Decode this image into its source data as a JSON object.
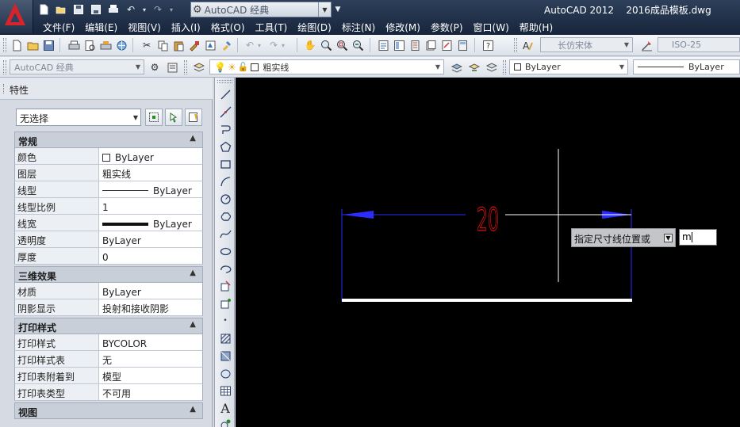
{
  "titlebar": {
    "app_name": "AutoCAD 2012",
    "file_name": "2016成品模板.dwg",
    "workspace": "AutoCAD 经典"
  },
  "menu": [
    "文件(F)",
    "编辑(E)",
    "视图(V)",
    "插入(I)",
    "格式(O)",
    "工具(T)",
    "绘图(D)",
    "标注(N)",
    "修改(M)",
    "参数(P)",
    "窗口(W)",
    "帮助(H)"
  ],
  "toolbar1": {
    "text_style": "长仿宋体",
    "dim_style": "ISO-25"
  },
  "toolbar2": {
    "workspace": "AutoCAD 经典",
    "layer": "粗实线",
    "color": "ByLayer",
    "linetype": "ByLayer"
  },
  "properties_palette": {
    "title": "特性",
    "selection": "无选择",
    "sections": [
      {
        "title": "常规",
        "rows": [
          {
            "key": "颜色",
            "value": "ByLayer",
            "marker": "swatch"
          },
          {
            "key": "图层",
            "value": "粗实线",
            "marker": ""
          },
          {
            "key": "线型",
            "value": "ByLayer",
            "marker": "line"
          },
          {
            "key": "线型比例",
            "value": "1",
            "marker": ""
          },
          {
            "key": "线宽",
            "value": "ByLayer",
            "marker": "thick"
          },
          {
            "key": "透明度",
            "value": "ByLayer",
            "marker": ""
          },
          {
            "key": "厚度",
            "value": "0",
            "marker": ""
          }
        ]
      },
      {
        "title": "三维效果",
        "rows": [
          {
            "key": "材质",
            "value": "ByLayer",
            "marker": ""
          },
          {
            "key": "阴影显示",
            "value": "投射和接收阴影",
            "marker": ""
          }
        ]
      },
      {
        "title": "打印样式",
        "rows": [
          {
            "key": "打印样式",
            "value": "BYCOLOR",
            "marker": ""
          },
          {
            "key": "打印样式表",
            "value": "无",
            "marker": ""
          },
          {
            "key": "打印表附着到",
            "value": "模型",
            "marker": ""
          },
          {
            "key": "打印表类型",
            "value": "不可用",
            "marker": ""
          }
        ]
      },
      {
        "title": "视图",
        "rows": []
      }
    ]
  },
  "drawing": {
    "dimension_text": "20",
    "dim_color": "#2c2cff",
    "text_color": "#e01010",
    "object_color": "#ffffff",
    "crosshair_color": "#ffffff"
  },
  "command": {
    "prompt": "指定尺寸线位置或",
    "input": "m"
  },
  "colors": {
    "title_bg": "#1e2d45",
    "canvas_bg": "#000000",
    "palette_bg": "#d6dbe3"
  }
}
